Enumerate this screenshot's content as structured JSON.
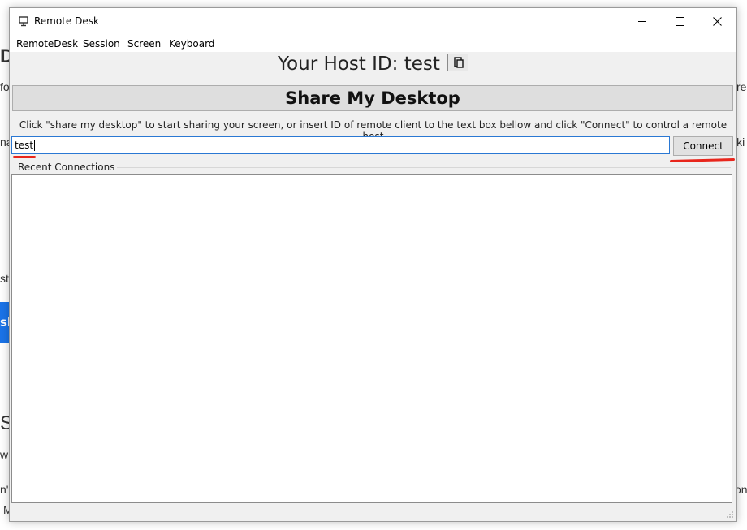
{
  "window": {
    "title": "Remote Desk"
  },
  "menu": {
    "items": [
      "RemoteDesk",
      "Session",
      "Screen",
      "Keyboard"
    ]
  },
  "host": {
    "label": "Your Host ID: test"
  },
  "share_button": {
    "label": "Share My Desktop"
  },
  "hint_text": "Click \"share my desktop\" to start sharing your screen, or insert ID of remote client to the text box bellow and click \"Connect\" to control a remote host",
  "remote_id_input": {
    "value": "test"
  },
  "connect_button": {
    "label": "Connect"
  },
  "recent": {
    "label": "Recent Connections"
  },
  "background": {
    "fragments": [
      "D",
      "fo",
      "re",
      "na",
      "lki",
      "st",
      "sk",
      "S",
      "w",
      "n'",
      "on",
      "M"
    ]
  },
  "colors": {
    "accent_blue": "#2a78d3",
    "annotation_red": "#e8261c",
    "background_button_blue": "#1a73e8"
  }
}
